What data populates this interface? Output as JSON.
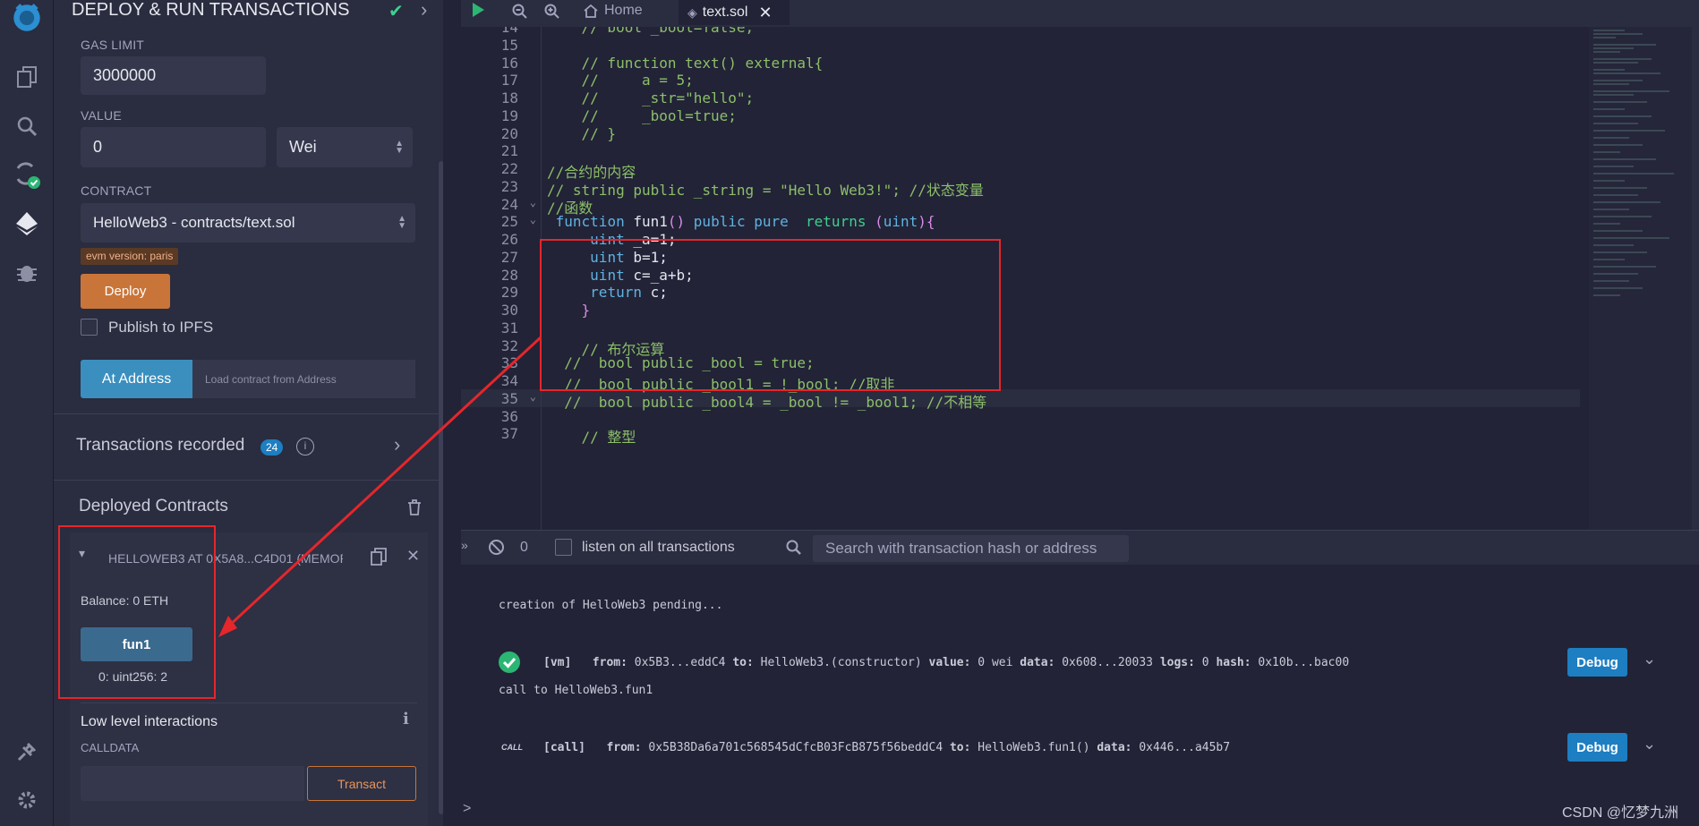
{
  "sidebar_plugin": {
    "title": "DEPLOY & RUN TRANSACTIONS",
    "gas_limit_label": "GAS LIMIT",
    "gas_limit_value": "3000000",
    "value_label": "VALUE",
    "value_amount": "0",
    "value_unit": "Wei",
    "contract_label": "CONTRACT",
    "contract_value": "HelloWeb3 - contracts/text.sol",
    "evm_badge": "evm version: paris",
    "deploy_label": "Deploy",
    "publish_label": "Publish to IPFS",
    "at_address_label": "At Address",
    "at_address_placeholder": "Load contract from Address",
    "transactions_recorded_label": "Transactions recorded",
    "transactions_recorded_count": "24",
    "deployed_contracts_label": "Deployed Contracts",
    "instance_title": "HELLOWEB3 AT 0X5A8...C4D01 (MEMOR",
    "balance_label": "Balance: 0 ETH",
    "fun1_label": "fun1",
    "fun1_result": "0: uint256: 2",
    "low_level_label": "Low level interactions",
    "calldata_label": "CALLDATA",
    "transact_label": "Transact"
  },
  "tabs": {
    "home_label": "Home",
    "file_label": "text.sol"
  },
  "editor": {
    "lines": [
      {
        "n": "14",
        "t": "    // bool _bool=false;"
      },
      {
        "n": "15",
        "t": ""
      },
      {
        "n": "16",
        "t": "    // function text() external{"
      },
      {
        "n": "17",
        "t": "    //     a = 5;"
      },
      {
        "n": "18",
        "t": "    //     _str=\"hello\";"
      },
      {
        "n": "19",
        "t": "    //     _bool=true;"
      },
      {
        "n": "20",
        "t": "    // }"
      },
      {
        "n": "21",
        "t": ""
      },
      {
        "n": "22",
        "t": "//合约的内容"
      },
      {
        "n": "23",
        "t": "// string public _string = \"Hello Web3!\"; //状态变量"
      },
      {
        "n": "24",
        "t": "//函数"
      },
      {
        "n": "25",
        "t": " function fun1() public pure  returns (uint){"
      },
      {
        "n": "26",
        "t": "     uint _a=1;"
      },
      {
        "n": "27",
        "t": "     uint b=1;"
      },
      {
        "n": "28",
        "t": "     uint c=_a+b;"
      },
      {
        "n": "29",
        "t": "     return c;"
      },
      {
        "n": "30",
        "t": "    }"
      },
      {
        "n": "31",
        "t": ""
      },
      {
        "n": "32",
        "t": "    // 布尔运算"
      },
      {
        "n": "33",
        "t": "  //  bool public _bool = true;"
      },
      {
        "n": "34",
        "t": "  //  bool public _bool1 = !_bool; //取非"
      },
      {
        "n": "35",
        "t": "  //  bool public _bool4 = _bool != _bool1; //不相等"
      },
      {
        "n": "36",
        "t": ""
      },
      {
        "n": "37",
        "t": "    // 整型"
      }
    ]
  },
  "terminal": {
    "pending_count": "0",
    "listen_label": "listen on all transactions",
    "search_placeholder": "Search with transaction hash or address",
    "creation_msg": "creation of HelloWeb3 pending...",
    "tx1_tag": "[vm]",
    "tx1_from_label": "from:",
    "tx1_from": "0x5B3...eddC4",
    "tx1_to_label": "to:",
    "tx1_to": "HelloWeb3.(constructor)",
    "tx1_value_label": "value:",
    "tx1_value": "0 wei",
    "tx1_data_label": "data:",
    "tx1_data": "0x608...20033",
    "tx1_logs_label": "logs:",
    "tx1_logs": "0",
    "tx1_hash_label": "hash:",
    "tx1_hash": "0x10b...bac00",
    "call_msg": "call to HelloWeb3.fun1",
    "call_icon": "CALL",
    "tx2_tag": "[call]",
    "tx2_from_label": "from:",
    "tx2_from": "0x5B38Da6a701c568545dCfcB03FcB875f56beddC4",
    "tx2_to_label": "to:",
    "tx2_to": "HelloWeb3.fun1()",
    "tx2_data_label": "data:",
    "tx2_data": "0x446...a45b7",
    "debug_label": "Debug",
    "prompt": ">"
  },
  "watermark": "CSDN @忆梦九洲",
  "colors": {
    "deploy": "#c97539",
    "at_address": "#3a8fbf",
    "fun1": "#3b6a8f",
    "debug": "#1d7ec2",
    "annotation": "#e5262b"
  }
}
